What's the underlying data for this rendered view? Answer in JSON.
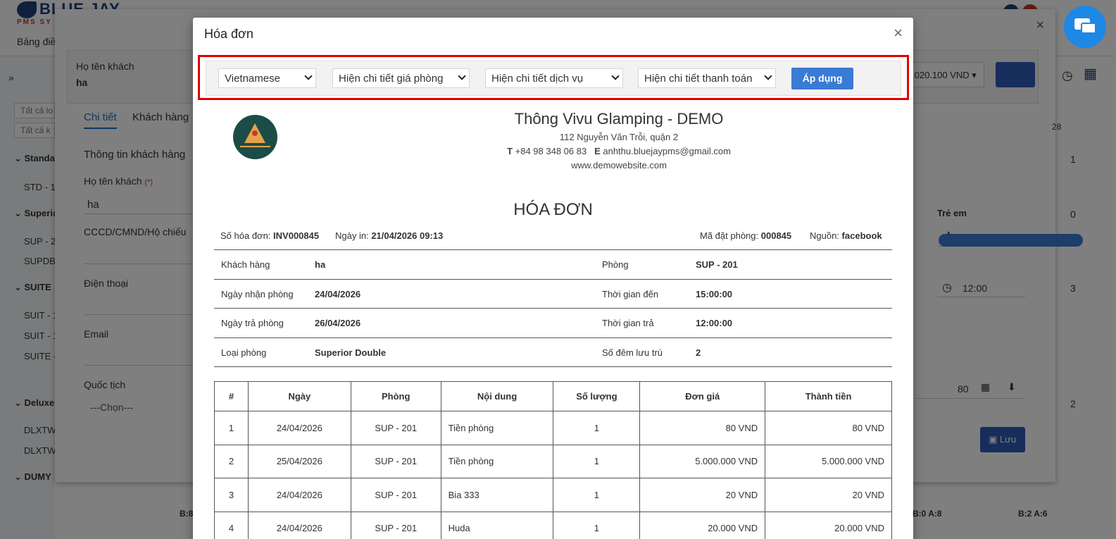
{
  "app": {
    "logo_text": "BLUE JAY",
    "logo_sub": "PMS SY",
    "nav_dashboard": "Bảng điề"
  },
  "sidebar": {
    "filters": [
      "Tất cả lo",
      "Tất cả k"
    ],
    "groups": [
      {
        "label": "Standa",
        "rooms": [
          "STD - 1"
        ]
      },
      {
        "label": "Superio",
        "rooms": [
          "SUP - 2",
          "SUPDBL"
        ]
      },
      {
        "label": "SUITE",
        "rooms": [
          "SUIT - 1",
          "SUIT - 1",
          "SUITE -"
        ]
      },
      {
        "label": "Deluxe",
        "rooms": [
          "DLXTW",
          "DLXTW"
        ]
      },
      {
        "label": "DUMY",
        "rooms": []
      }
    ]
  },
  "booking": {
    "guest_label": "Họ tên khách",
    "guest_value": "ha",
    "tabs": [
      "Chi tiết",
      "Khách hàng"
    ],
    "section_title": "Thông tin khách hàng",
    "field_name_label": "Họ tên khách",
    "required_mark": "(*)",
    "field_name_value": "ha",
    "field_id_label": "CCCD/CMND/Hộ chiếu",
    "field_phone_label": "Điện thoại",
    "field_email_label": "Email",
    "field_nationality_label": "Quốc tịch",
    "field_nationality_value": "---Chọn---",
    "total_amount": ".020.100 VND",
    "children_label": "Trẻ em",
    "children_value": "0",
    "time_value": "12:00",
    "price_value": "80",
    "save_label": "Lưu",
    "right_counts": [
      "28",
      "1",
      "0",
      "3",
      "2"
    ],
    "footer_stats": [
      "B:8",
      "B:0 A:8",
      "B:2 A:6"
    ]
  },
  "modal": {
    "title": "Hóa đơn",
    "close": "×",
    "options": {
      "language": "Vietnamese",
      "room_detail": "Hiện chi tiết giá phòng",
      "service_detail": "Hiện chi tiết dịch vụ",
      "payment_detail": "Hiện chi tiết thanh toán",
      "apply": "Áp dụng"
    },
    "company": {
      "name": "Thông Vivu Glamping - DEMO",
      "address": "112 Nguyễn Văn Trỗi, quận 2",
      "phone_prefix": "T",
      "phone": "+84 98 348 06 83",
      "email_prefix": "E",
      "email": "anhthu.bluejaypms@gmail.com",
      "website": "www.demowebsite.com"
    },
    "invoice_title": "HÓA ĐƠN",
    "meta": {
      "invoice_no_label": "Số hóa đơn:",
      "invoice_no": "INV000845",
      "print_date_label": "Ngày in:",
      "print_date": "21/04/2026 09:13",
      "booking_code_label": "Mã đặt phòng:",
      "booking_code": "000845",
      "source_label": "Nguồn:",
      "source": "facebook"
    },
    "info": [
      {
        "l1": "Khách hàng",
        "v1": "ha",
        "l2": "Phòng",
        "v2": "SUP - 201"
      },
      {
        "l1": "Ngày nhận phòng",
        "v1": "24/04/2026",
        "l2": "Thời gian đến",
        "v2": "15:00:00"
      },
      {
        "l1": "Ngày trả phòng",
        "v1": "26/04/2026",
        "l2": "Thời gian trả",
        "v2": "12:00:00"
      },
      {
        "l1": "Loại phòng",
        "v1": "Superior Double",
        "l2": "Số đêm lưu trú",
        "v2": "2"
      }
    ],
    "items_headers": [
      "#",
      "Ngày",
      "Phòng",
      "Nội dung",
      "Số lượng",
      "Đơn giá",
      "Thành tiền"
    ],
    "items": [
      {
        "no": "1",
        "date": "24/04/2026",
        "room": "SUP - 201",
        "desc": "Tiền phòng",
        "qty": "1",
        "price": "80 VND",
        "total": "80 VND"
      },
      {
        "no": "2",
        "date": "25/04/2026",
        "room": "SUP - 201",
        "desc": "Tiền phòng",
        "qty": "1",
        "price": "5.000.000 VND",
        "total": "5.000.000 VND"
      },
      {
        "no": "3",
        "date": "24/04/2026",
        "room": "SUP - 201",
        "desc": "Bia 333",
        "qty": "1",
        "price": "20 VND",
        "total": "20 VND"
      },
      {
        "no": "4",
        "date": "24/04/2026",
        "room": "SUP - 201",
        "desc": "Huda",
        "qty": "1",
        "price": "20.000 VND",
        "total": "20.000 VND"
      }
    ]
  }
}
